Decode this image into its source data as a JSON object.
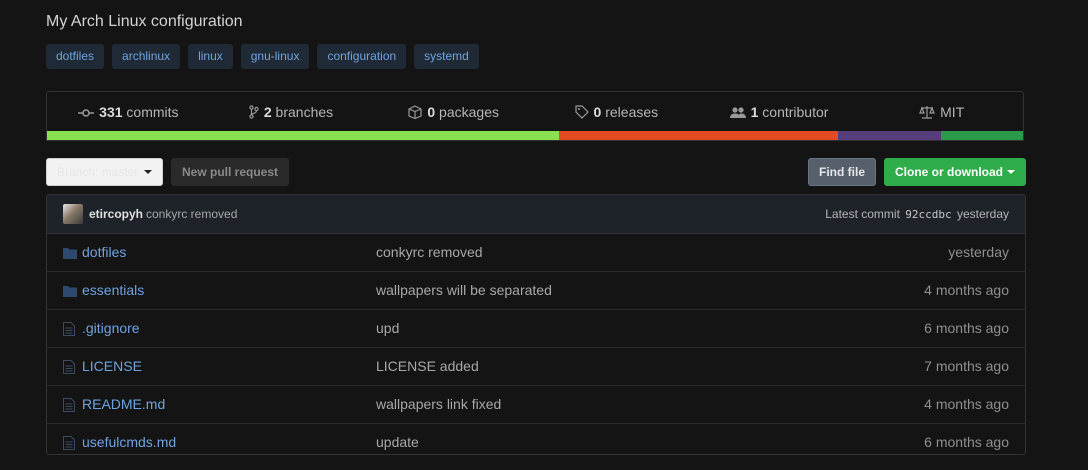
{
  "repo": {
    "description": "My Arch Linux configuration"
  },
  "topics": [
    "dotfiles",
    "archlinux",
    "linux",
    "gnu-linux",
    "configuration",
    "systemd"
  ],
  "stats": [
    {
      "icon": "commits-icon",
      "count": "331",
      "label": " commits"
    },
    {
      "icon": "branch-icon",
      "count": "2",
      "label": " branches"
    },
    {
      "icon": "package-icon",
      "count": "0",
      "label": " packages"
    },
    {
      "icon": "tag-icon",
      "count": "0",
      "label": " releases"
    },
    {
      "icon": "people-icon",
      "count": "1",
      "label": " contributor"
    },
    {
      "icon": "law-icon",
      "count": "",
      "label": "MIT"
    }
  ],
  "languages": [
    {
      "color": "#89e051",
      "share": 52.5
    },
    {
      "color": "#e44b23",
      "share": 28.5
    },
    {
      "color": "#563d7c",
      "share": 10.6
    },
    {
      "color": "#2b9a4a",
      "share": 8.4
    }
  ],
  "toolbar": {
    "branch_label": "Branch: master",
    "new_pr": "New pull request",
    "find_file": "Find file",
    "clone": "Clone or download"
  },
  "latest_commit": {
    "author": "etircopyh",
    "message": "conkyrc removed",
    "prefix": "Latest commit",
    "sha": "92ccdbc",
    "time": "yesterday"
  },
  "files": [
    {
      "type": "dir",
      "name": "dotfiles",
      "message": "conkyrc removed",
      "age": "yesterday"
    },
    {
      "type": "dir",
      "name": "essentials",
      "message": "wallpapers will be separated",
      "age": "4 months ago"
    },
    {
      "type": "file",
      "name": ".gitignore",
      "message": "upd",
      "age": "6 months ago"
    },
    {
      "type": "file",
      "name": "LICENSE",
      "message": "LICENSE added",
      "age": "7 months ago"
    },
    {
      "type": "file",
      "name": "README.md",
      "message": "wallpapers link fixed",
      "age": "4 months ago"
    },
    {
      "type": "file",
      "name": "usefulcmds.md",
      "message": "update",
      "age": "6 months ago"
    }
  ]
}
